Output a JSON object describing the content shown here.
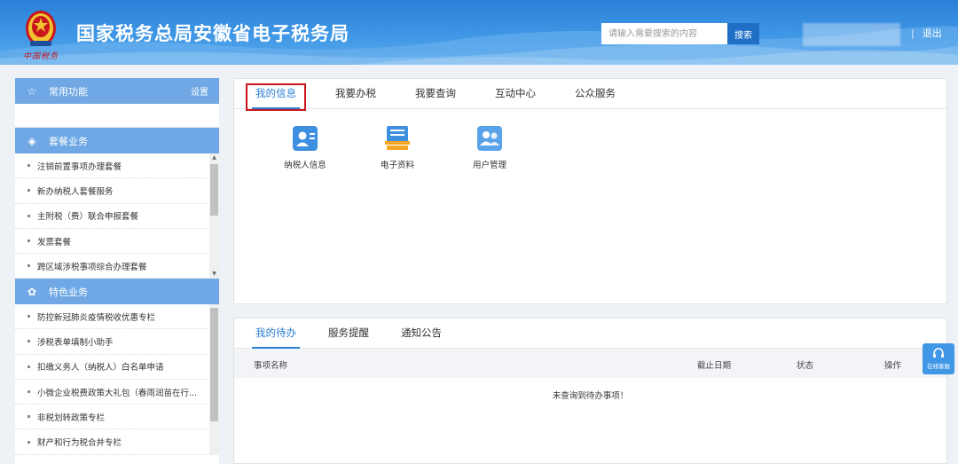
{
  "header": {
    "site_title": "国家税务总局安徽省电子税务局",
    "slogan": "中国税务",
    "search_placeholder": "请输入需要搜索的内容",
    "search_label": "搜索",
    "logout_label": "退出",
    "brand_color": "#2b7fd6"
  },
  "sidebar": {
    "common": {
      "title": "常用功能",
      "setting_label": "设置",
      "icon": "star-icon"
    },
    "package": {
      "title": "套餐业务",
      "icon": "layers-icon",
      "items": [
        "注销前置事项办理套餐",
        "新办纳税人套餐服务",
        "主附税（费）联合申报套餐",
        "发票套餐",
        "跨区域涉税事项综合办理套餐"
      ]
    },
    "special": {
      "title": "特色业务",
      "icon": "grid-flower-icon",
      "items": [
        "防控新冠肺炎疫情税收优惠专栏",
        "涉税表单填制小助手",
        "扣缴义务人（纳税人）白名单申请",
        "小微企业税费政策大礼包（春雨润苗在行...",
        "非税划转政策专栏",
        "财产和行为税合并专栏"
      ]
    }
  },
  "main_tabs": [
    "我的信息",
    "我要办税",
    "我要查询",
    "互动中心",
    "公众服务"
  ],
  "apps": [
    {
      "label": "纳税人信息",
      "icon": "taxpayer-card-icon"
    },
    {
      "label": "电子资料",
      "icon": "document-stack-icon"
    },
    {
      "label": "用户管理",
      "icon": "users-icon"
    }
  ],
  "todo": {
    "tabs": [
      "我的待办",
      "服务提醒",
      "通知公告"
    ],
    "columns": [
      "事项名称",
      "截止日期",
      "状态",
      "操作"
    ],
    "empty_text": "未查询到待办事项！"
  },
  "service": {
    "label": "在线客服",
    "icon": "headset-icon"
  }
}
